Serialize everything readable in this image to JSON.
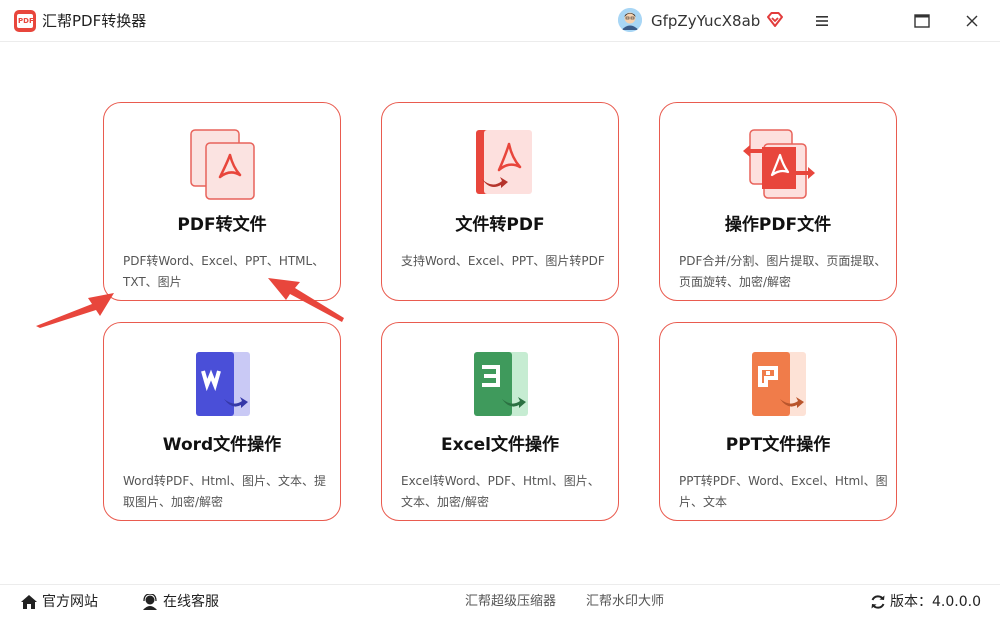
{
  "app": {
    "title": "汇帮PDF转换器",
    "logo_text": "PDF"
  },
  "user": {
    "name": "GfpZyYucX8ab"
  },
  "cards": [
    {
      "title": "PDF转文件",
      "desc": "PDF转Word、Excel、PPT、HTML、TXT、图片"
    },
    {
      "title": "文件转PDF",
      "desc": "支持Word、Excel、PPT、图片转PDF"
    },
    {
      "title": "操作PDF文件",
      "desc": "PDF合并/分割、图片提取、页面提取、页面旋转、加密/解密"
    },
    {
      "title": "Word文件操作",
      "desc": "Word转PDF、Html、图片、文本、提取图片、加密/解密"
    },
    {
      "title": "Excel文件操作",
      "desc": "Excel转Word、PDF、Html、图片、文本、加密/解密"
    },
    {
      "title": "PPT文件操作",
      "desc": "PPT转PDF、Word、Excel、Html、图片、文本"
    }
  ],
  "footer": {
    "website": "官方网站",
    "support": "在线客服",
    "compressor": "汇帮超级压缩器",
    "watermark": "汇帮水印大师",
    "version": "版本：4.0.0.0"
  },
  "colors": {
    "accent": "#e95b4f",
    "word": "#4a4fd8",
    "excel": "#3f9a5c",
    "ppt": "#f07c4a"
  },
  "icons": {
    "home": "home-icon",
    "support": "headset-icon",
    "refresh": "refresh-icon",
    "menu": "menu-icon",
    "maximize": "maximize-icon",
    "close": "close-icon",
    "vip": "diamond-icon"
  }
}
